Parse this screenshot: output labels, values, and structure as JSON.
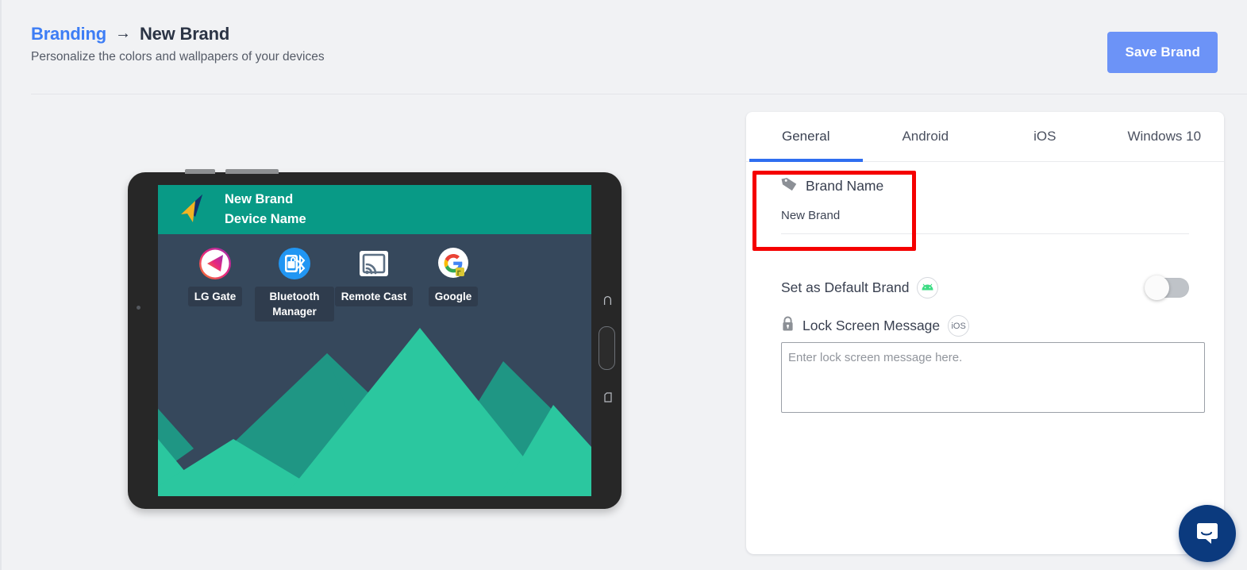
{
  "header": {
    "breadcrumb_link": "Branding",
    "breadcrumb_arrow": "→",
    "breadcrumb_current": "New Brand",
    "subtitle": "Personalize the colors and wallpapers of your devices",
    "save_button": "Save Brand"
  },
  "colors": {
    "accent_blue": "#3d7df5",
    "save_button_bg": "#6c93f7",
    "tab_underline": "#2f6ef0",
    "highlight_outline": "#f50000",
    "device_topbar": "#089a86",
    "wallpaper_sky": "#36485c",
    "wallpaper_mountain_back": "#1f9684",
    "wallpaper_mountain_front": "#2bc79f",
    "intercom_bg": "#0b3a7e"
  },
  "device_preview": {
    "topbar_brand_name": "New Brand",
    "topbar_device_name": "Device Name",
    "logo_icon": "brand-arrow-logo-icon",
    "side_buttons": {
      "headphone_jack_icon": "headphone-jack-icon",
      "power_button_icon": "power-button-icon",
      "sd_card_icon": "sd-card-slot-icon",
      "volume_buttons_icon": "volume-buttons-icon",
      "front_camera_icon": "front-camera-icon"
    },
    "apps": [
      {
        "label": "LG Gate",
        "icon": "lg-gate-app-icon"
      },
      {
        "label": "Bluetooth Manager",
        "icon": "bluetooth-manager-app-icon"
      },
      {
        "label": "Remote Cast",
        "icon": "remote-cast-app-icon"
      },
      {
        "label": "Google",
        "icon": "google-app-icon"
      }
    ]
  },
  "panel": {
    "tabs": [
      {
        "label": "General",
        "active": true
      },
      {
        "label": "Android",
        "active": false
      },
      {
        "label": "iOS",
        "active": false
      },
      {
        "label": "Windows 10",
        "active": false
      }
    ],
    "brand_name": {
      "label": "Brand Name",
      "icon": "tag-icon",
      "value": "New Brand"
    },
    "default_brand": {
      "label": "Set as Default Brand",
      "platform_badge": "android-badge-icon",
      "toggle_state": "off"
    },
    "lock_screen": {
      "label": "Lock Screen Message",
      "icon": "lock-icon",
      "platform_badge": "iOS",
      "placeholder": "Enter lock screen message here.",
      "value": ""
    }
  },
  "intercom": {
    "icon": "chat-bubble-icon",
    "label": "Open chat"
  }
}
